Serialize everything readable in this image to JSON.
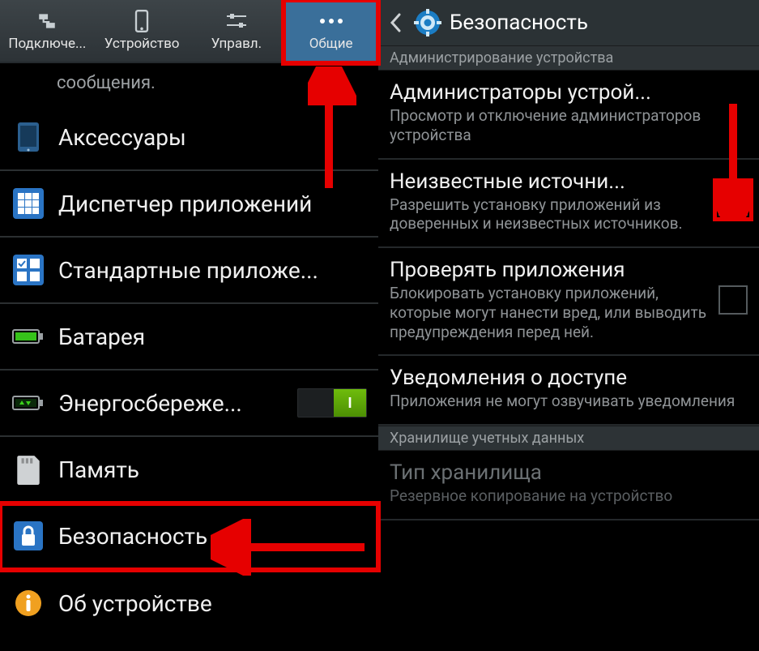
{
  "tabs": {
    "connect": "Подключе...",
    "device": "Устройство",
    "control": "Управл.",
    "general": "Общие"
  },
  "left": {
    "partial": "сообщения.",
    "items": [
      {
        "key": "accessories",
        "label": "Аксессуары"
      },
      {
        "key": "appmanager",
        "label": "Диспетчер приложений"
      },
      {
        "key": "defaultapps",
        "label": "Стандартные приложе..."
      },
      {
        "key": "battery",
        "label": "Батарея"
      },
      {
        "key": "powersave",
        "label": "Энергосбереже..."
      },
      {
        "key": "memory",
        "label": "Память"
      },
      {
        "key": "security",
        "label": "Безопасность"
      },
      {
        "key": "about",
        "label": "Об устройстве"
      }
    ],
    "toggle_on": "I"
  },
  "right": {
    "title": "Безопасность",
    "section1": "Администрирование устройства",
    "rows": {
      "admins": {
        "title": "Администраторы устрой...",
        "desc": "Просмотр и отключение администраторов устройства"
      },
      "unknown": {
        "title": "Неизвестные источни...",
        "desc": "Разрешить установку приложений из доверенных и неизвестных источников."
      },
      "verify": {
        "title": "Проверять приложения",
        "desc": "Блокировать установку приложений, которые могут нанести вред, или выводить предупреждения перед ней."
      },
      "access": {
        "title": "Уведомления о доступе",
        "desc": "Приложения не могут озвучивать уведомления"
      }
    },
    "section2": "Хранилище учетных данных",
    "disabled": {
      "title": "Тип хранилища",
      "desc": "Резервное копирование на устройство"
    }
  }
}
